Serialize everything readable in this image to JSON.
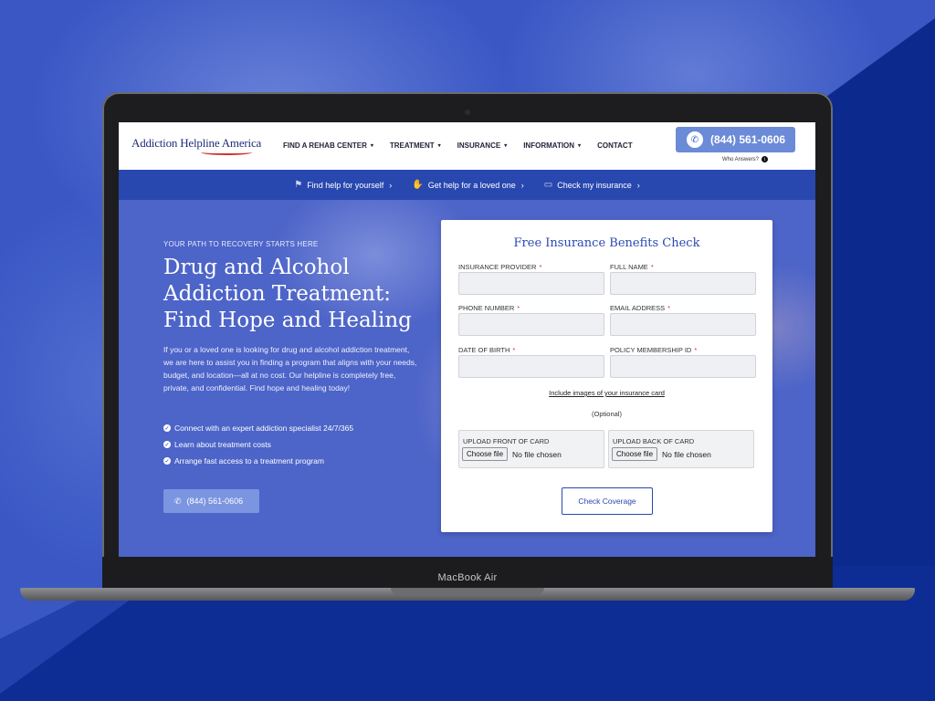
{
  "device": {
    "label": "MacBook Air"
  },
  "header": {
    "logo_text": "Addiction Helpline America",
    "nav": [
      {
        "label": "FIND A REHAB CENTER",
        "has_dropdown": true
      },
      {
        "label": "TREATMENT",
        "has_dropdown": true
      },
      {
        "label": "INSURANCE",
        "has_dropdown": true
      },
      {
        "label": "INFORMATION",
        "has_dropdown": true
      },
      {
        "label": "CONTACT",
        "has_dropdown": false
      }
    ],
    "phone": "(844) 561-0606",
    "who_answers": "Who Answers?",
    "caret": "▾",
    "info_glyph": "i"
  },
  "subnav": [
    {
      "label": "Find help for yourself",
      "icon": "flag-icon"
    },
    {
      "label": "Get help for a loved one",
      "icon": "helping-hand-icon"
    },
    {
      "label": "Check my insurance",
      "icon": "card-icon"
    }
  ],
  "hero": {
    "eyebrow": "YOUR PATH TO RECOVERY STARTS HERE",
    "title": "Drug and Alcohol Addiction Treatment: Find Hope and Healing",
    "body": "If you or a loved one is looking for drug and alcohol addiction treatment, we are here to assist you in finding a program that aligns with your needs, budget, and location—all at no cost. Our helpline is completely free, private, and confidential. Find hope and healing today!",
    "bullets": [
      "Connect with an expert addiction specialist 24/7/365",
      "Learn about treatment costs",
      "Arrange fast access to a treatment program"
    ],
    "phone": "(844) 561-0606"
  },
  "form": {
    "title": "Free Insurance Benefits Check",
    "fields": {
      "insurance_provider": "INSURANCE PROVIDER",
      "full_name": "FULL NAME",
      "phone_number": "PHONE NUMBER",
      "email_address": "EMAIL ADDRESS",
      "date_of_birth": "DATE OF BIRTH",
      "policy_id": "POLICY MEMBERSHIP ID"
    },
    "required_mark": "*",
    "include_link": "Include images of your insurance card",
    "optional": "(Optional)",
    "upload_front": "UPLOAD FRONT OF CARD",
    "upload_back": "UPLOAD BACK OF CARD",
    "choose_file": "Choose file",
    "no_file": "No file chosen",
    "submit": "Check Coverage"
  },
  "colors": {
    "brand_blue": "#2848b0",
    "accent_red": "#d0312d",
    "phone_button": "#6b8ad8"
  }
}
